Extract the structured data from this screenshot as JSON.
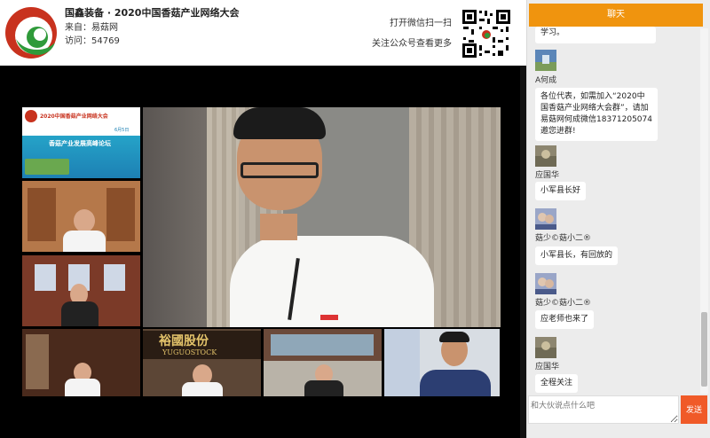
{
  "header": {
    "title": "国鑫装备 · 2020中国香菇产业网络大会",
    "source_label": "来自：",
    "source_value": "易菇网",
    "visits_label": "访问：",
    "visits_value": "54769",
    "scan_text": "打开微信扫一扫",
    "follow_text": "关注公众号查看更多"
  },
  "video": {
    "slide_title": "2020中国香菇产业网络大会",
    "slide_sub": "香菇产业发展高峰论坛",
    "slide_date": "6月5日",
    "banner_brand": "裕國股份",
    "banner_en": "YUGUOSTOCK"
  },
  "chat": {
    "tab_label": "聊天",
    "messages": [
      {
        "user": "",
        "text": "学习。"
      },
      {
        "user": "A何成",
        "text": "各位代表，如需加入“2020中国香菇产业网络大会群”，请加易菇网何成微信18371205074邀您进群!"
      },
      {
        "user": "应国华",
        "text": "小军县长好"
      },
      {
        "user": "菇少©菇小二®",
        "text": "小军县长，有回放的"
      },
      {
        "user": "菇少©菇小二®",
        "text": "应老师也来了"
      },
      {
        "user": "应国华",
        "text": "全程关注"
      }
    ],
    "input_placeholder": "和大伙说点什么吧",
    "send_label": "发送"
  },
  "colors": {
    "accent": "#f0940e",
    "send": "#f05a28"
  }
}
